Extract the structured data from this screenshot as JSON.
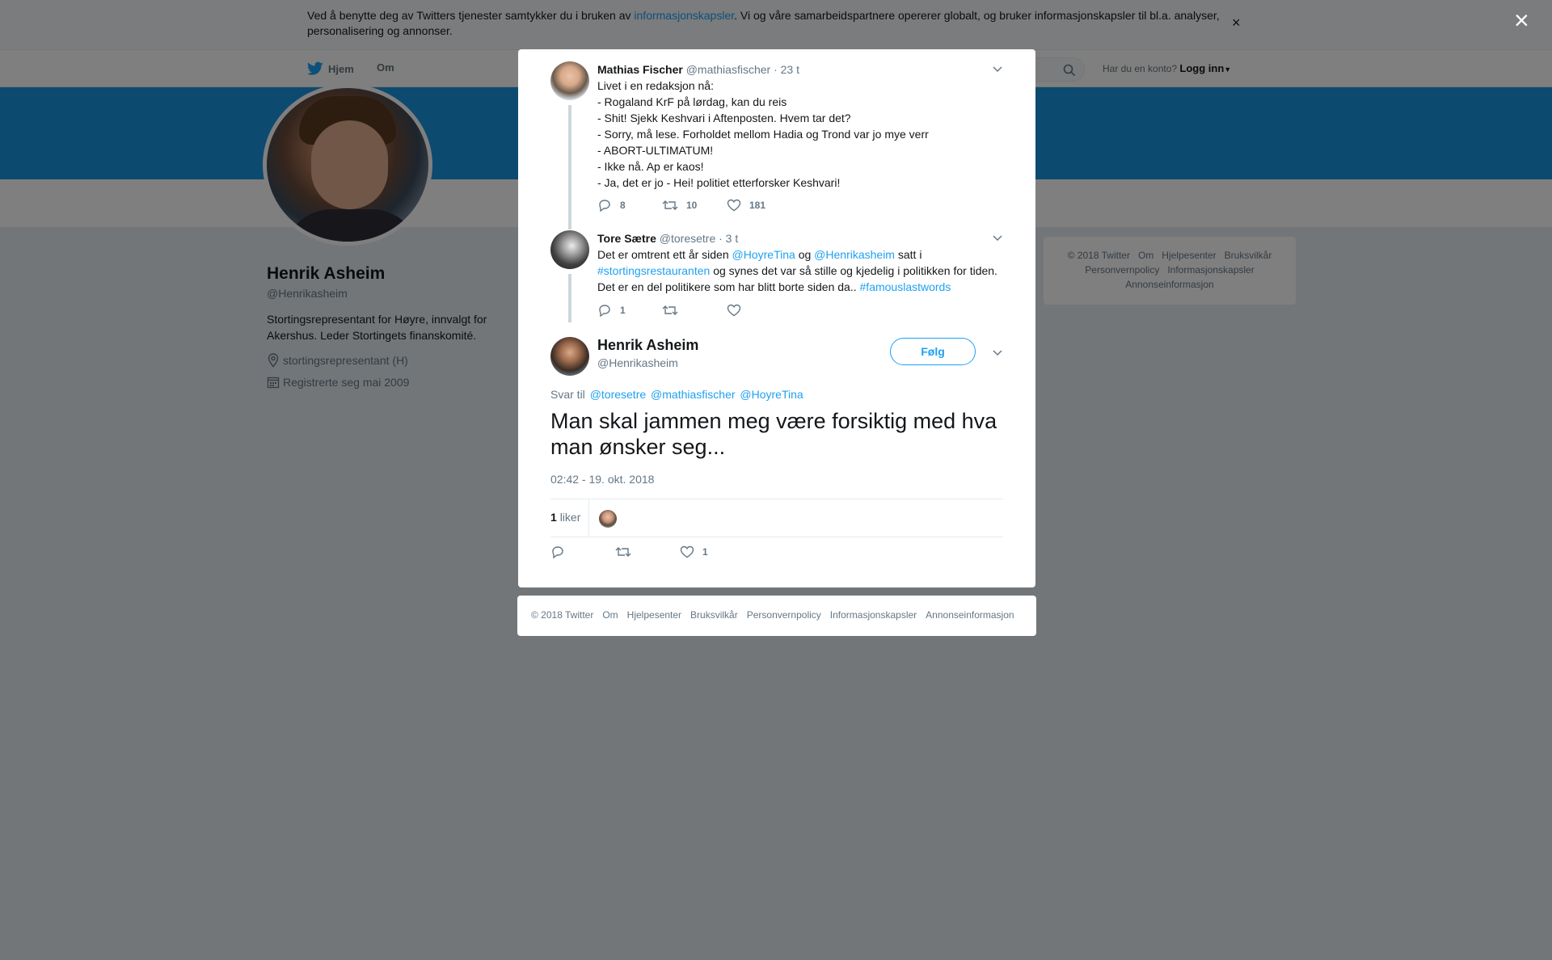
{
  "cookie": {
    "text_before": "Ved å benytte deg av Twitters tjenester samtykker du i bruken av ",
    "link": "informasjonskapsler",
    "text_after": ". Vi og våre samarbeidspartnere opererer globalt, og bruker informasjonskapsler til bl.a. analyser, personalisering og annonser.",
    "close": "×"
  },
  "nav": {
    "home": "Hjem",
    "about": "Om",
    "account_prompt": "Har du en konto?",
    "login": "Logg inn"
  },
  "profile": {
    "name": "Henrik Asheim",
    "handle": "@Henrikasheim",
    "bio": "Stortingsrepresentant for Høyre, innvalgt for Akershus. Leder Stortingets finanskomité.",
    "location": "stortingsrepresentant (H)",
    "joined": "Registrerte seg mai 2009"
  },
  "side_footer": {
    "items": [
      "© 2018 Twitter",
      "Om",
      "Hjelpesenter",
      "Bruksvilkår",
      "Personvernpolicy",
      "Informasjonskapsler",
      "Annonseinformasjon"
    ]
  },
  "overlay": {
    "close": "×"
  },
  "tweets": [
    {
      "name": "Mathias Fischer",
      "handle": "@mathiasfischer",
      "time": "· 23 t",
      "lines": [
        "Livet i en redaksjon nå:",
        "- Rogaland KrF på lørdag, kan du reis",
        "- Shit! Sjekk Keshvari i Aftenposten. Hvem tar det?",
        "- Sorry, må lese. Forholdet mellom Hadia og Trond var jo mye verr",
        "- ABORT-ULTIMATUM!",
        "- Ikke nå. Ap er kaos!",
        "- Ja, det er jo - Hei! politiet etterforsker Keshvari!"
      ],
      "replies": "8",
      "retweets": "10",
      "likes": "181"
    },
    {
      "name": "Tore Sætre",
      "handle": "@toresetre",
      "time": "· 3 t",
      "parts": {
        "t1": "Det er omtrent ett år siden ",
        "m1": "@HoyreTina",
        "t2": " og ",
        "m2": "@Henrikasheim",
        "t3": " satt i ",
        "h1": "#stortingsrestauranten",
        "t4": " og synes det var så stille og kjedelig i politikken for tiden. Det er en del politikere som har blitt borte siden da.. ",
        "h2": "#famouslastwords"
      },
      "replies": "1"
    }
  ],
  "main_tweet": {
    "name": "Henrik Asheim",
    "handle": "@Henrikasheim",
    "follow": "Følg",
    "reply_label": "Svar til",
    "reply_to": [
      "@toresetre",
      "@mathiasfischer",
      "@HoyreTina"
    ],
    "text": "Man skal jammen meg være forsiktig med hva man ønsker seg...",
    "timestamp": "02:42 - 19. okt. 2018",
    "likes_count": "1",
    "likes_label": "liker",
    "action_likes": "1"
  },
  "modal_footer": {
    "items": [
      "© 2018 Twitter",
      "Om",
      "Hjelpesenter",
      "Bruksvilkår",
      "Personvernpolicy",
      "Informasjonskapsler",
      "Annonseinformasjon"
    ]
  },
  "colors": {
    "accent": "#1da1f2",
    "banner": "#1b95e0",
    "muted": "#657786"
  }
}
